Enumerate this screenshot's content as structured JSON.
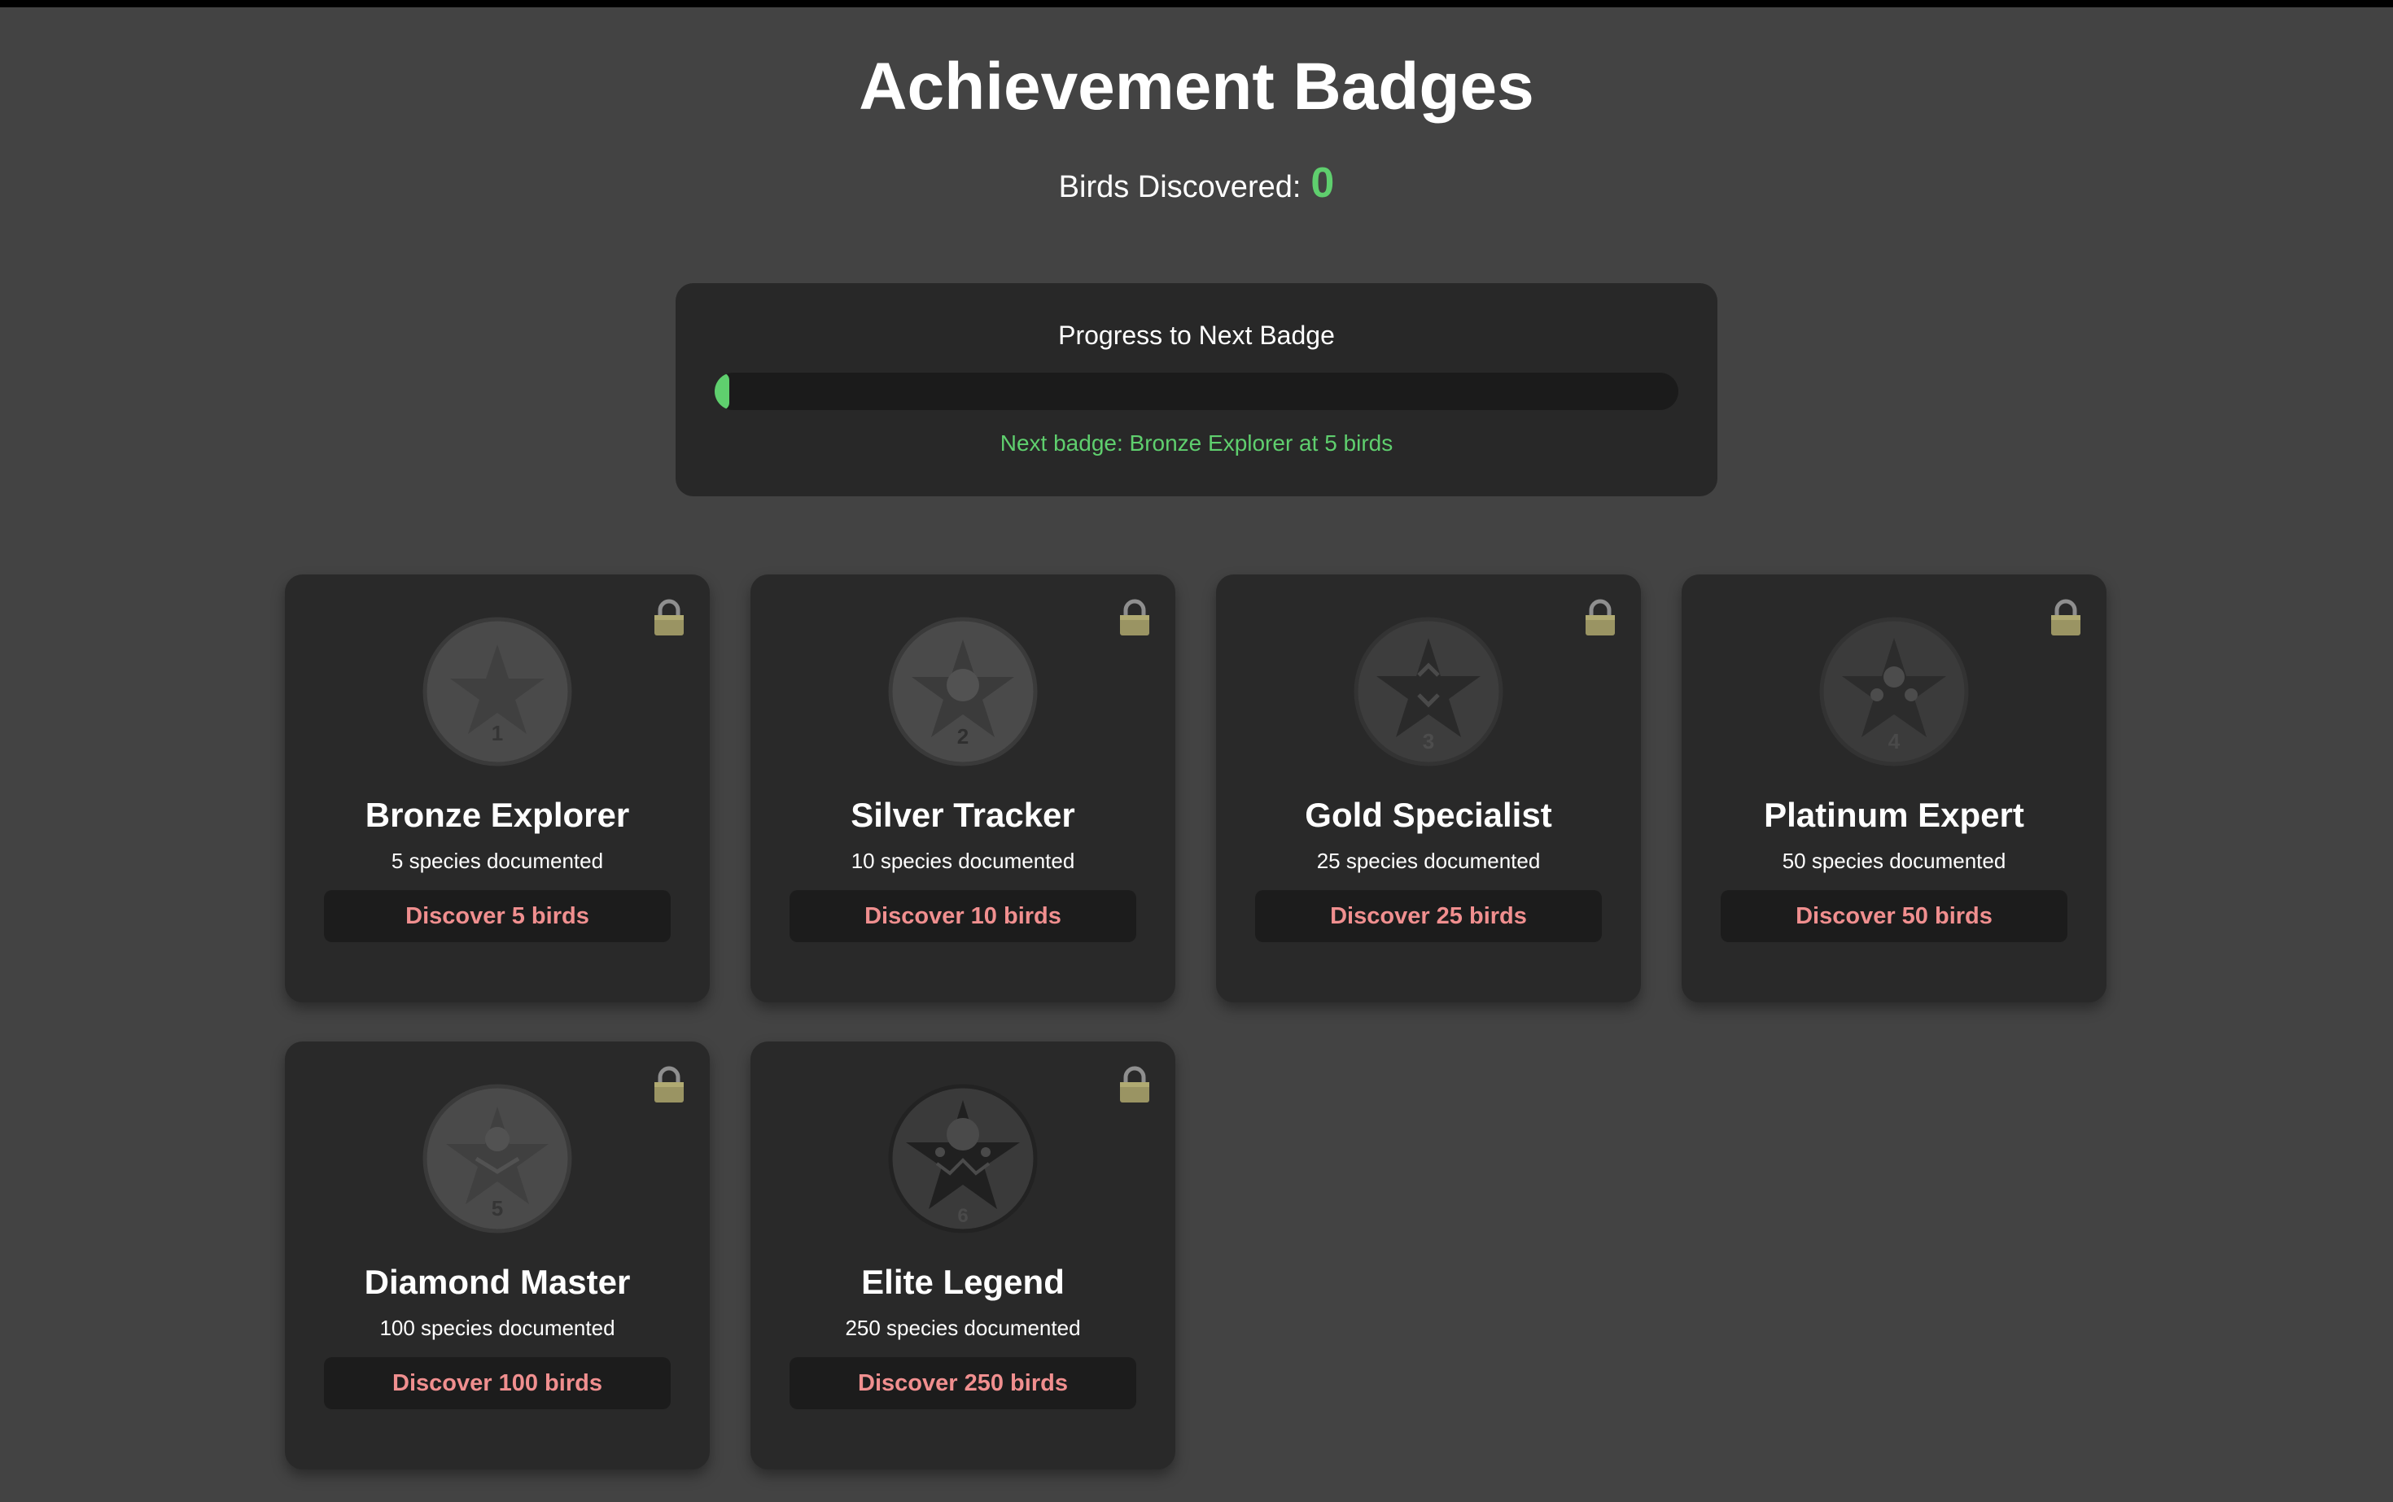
{
  "page": {
    "title": "Achievement Badges",
    "discovered_label": "Birds Discovered:",
    "discovered_count": "0"
  },
  "progress": {
    "title": "Progress to Next Badge",
    "percent": 1.5,
    "next_badge_text": "Next badge: Bronze Explorer at 5 birds",
    "fill_color": "#5fcf6e"
  },
  "badges": [
    {
      "name": "Bronze Explorer",
      "description": "5 species documented",
      "requirement": "Discover 5 birds",
      "number": "1",
      "icon": "star-medal-icon",
      "locked": true,
      "lock_icon": "lock-icon"
    },
    {
      "name": "Silver Tracker",
      "description": "10 species documented",
      "requirement": "Discover 10 birds",
      "number": "2",
      "icon": "star-circle-medal-icon",
      "locked": true,
      "lock_icon": "lock-icon"
    },
    {
      "name": "Gold Specialist",
      "description": "25 species documented",
      "requirement": "Discover 25 birds",
      "number": "3",
      "icon": "star-chevron-medal-icon",
      "locked": true,
      "lock_icon": "lock-icon"
    },
    {
      "name": "Platinum Expert",
      "description": "50 species documented",
      "requirement": "Discover 50 birds",
      "number": "4",
      "icon": "star-dots-medal-icon",
      "locked": true,
      "lock_icon": "lock-icon"
    },
    {
      "name": "Diamond Master",
      "description": "100 species documented",
      "requirement": "Discover 100 birds",
      "number": "5",
      "icon": "star-wings-medal-icon",
      "locked": true,
      "lock_icon": "lock-icon"
    },
    {
      "name": "Elite Legend",
      "description": "250 species documented",
      "requirement": "Discover 250 birds",
      "number": "6",
      "icon": "star-crown-medal-icon",
      "locked": true,
      "lock_icon": "lock-icon"
    }
  ],
  "colors": {
    "background": "#434343",
    "card": "#292929",
    "accent_green": "#5fcf6e",
    "requirement_red": "#f08f8f"
  }
}
